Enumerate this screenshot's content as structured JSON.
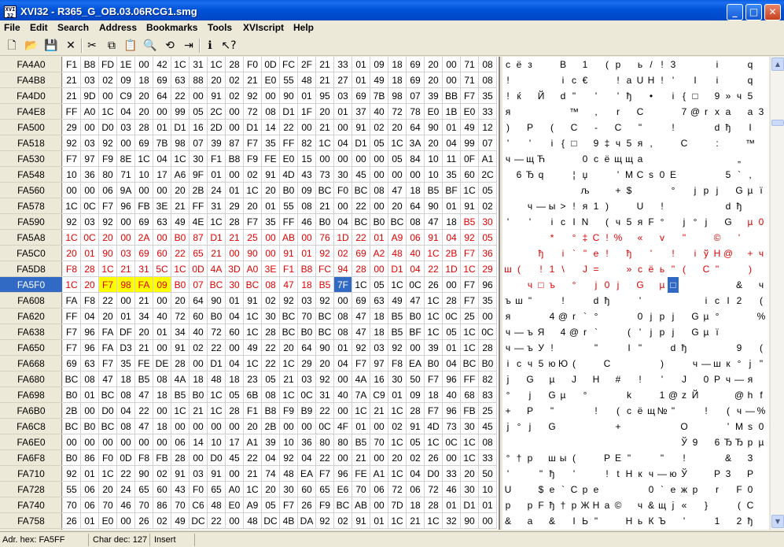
{
  "window": {
    "title": "XVI32 - R365_G_OB.03.06RCG1.smg",
    "app_icon": "XVI32-icon",
    "controls": {
      "minimize": "minimize-icon",
      "maximize": "maximize-icon",
      "close": "close-icon"
    }
  },
  "menu": [
    "File",
    "Edit",
    "Search",
    "Address",
    "Bookmarks",
    "Tools",
    "XVIscript",
    "Help"
  ],
  "toolbar": [
    "new-file-icon",
    "open-folder-icon",
    "save-icon",
    "delete-icon",
    "cut-icon",
    "copy-icon",
    "paste-icon",
    "search-icon",
    "replace-icon",
    "goto-icon",
    "info-icon",
    "help-icon"
  ],
  "addresses": [
    "FA4A0",
    "FA4B8",
    "FA4D0",
    "FA4E8",
    "FA500",
    "FA518",
    "FA530",
    "FA548",
    "FA560",
    "FA578",
    "FA590",
    "FA5A8",
    "FA5C0",
    "FA5D8",
    "FA5F0",
    "FA608",
    "FA620",
    "FA638",
    "FA650",
    "FA668",
    "FA680",
    "FA698",
    "FA6B0",
    "FA6C8",
    "FA6E0",
    "FA6F8",
    "FA710",
    "FA728",
    "FA740",
    "FA758"
  ],
  "selected_row": 14,
  "hex_rows": [
    "F1 B8 FD 1E 00 42 1C 31 1C 28 F0 0D FC 2F 21 33 01 09 18 69 20 00 71 08",
    "21 03 02 09 18 69 63 88 20 02 21 E0 55 48 21 27 01 49 18 69 20 00 71 08",
    "21 9D 00 C9 20 64 22 00 91 02 92 00 90 01 95 03 69 7B 98 07 39 BB F7 35",
    "FF A0 1C 04 20 00 99 05 2C 00 72 08 D1 1F 20 01 37 40 72 78 E0 1B E0 33",
    "29 00 D0 03 28 01 D1 16 2D 00 D1 14 22 00 21 00 91 02 20 64 90 01 49 12",
    "92 03 92 00 69 7B 98 07 39 87 F7 35 FF 82 1C 04 D1 05 1C 3A 20 04 99 07",
    "F7 97 F9 8E 1C 04 1C 30 F1 B8 F9 FE E0 15 00 00 00 00 05 84 10 11 0F A1",
    "10 36 80 71 10 17 A6 9F 01 00 02 91 4D 43 73 30 45 00 00 00 10 35 60 2C",
    "00 00 06 9A 00 00 20 2B 24 01 1C 20 B0 09 BC F0 BC 08 47 18 B5 BF 1C 05",
    "1C 0C F7 96 FB 3E 21 FF 31 29 20 01 55 08 21 00 22 00 20 64 90 01 91 02",
    "92 03 92 00 69 63 49 4E 1C 28 F7 35 FF 46 B0 04 BC B0 BC 08 47 18 B5 30",
    "1C 0C 20 00 2A 00 B0 87 D1 21 25 00 AB 00 76 1D 22 01 A9 06 91 04 92 05",
    "20 01 90 03 69 60 22 65 21 00 90 00 91 01 92 02 69 A2 48 40 1C 2B F7 36",
    "F8 28 1C 21 31 5C 1C 0D 4A 3D A0 3E F1 B8 FC 94 28 00 D1 04 22 1D 1C 29",
    "1C 20 F7 98 FA 09 B0 07 BC 30 BC 08 47 18 B5 7F 1C 05 1C 0C 26 00 F7 96",
    "FA F8 22 00 21 00 20 64 90 01 91 02 92 03 92 00 69 63 49 47 1C 28 F7 35",
    "FF 04 20 01 34 40 72 60 B0 04 1C 30 BC 70 BC 08 47 18 B5 B0 1C 0C 25 00",
    "F7 96 FA DF 20 01 34 40 72 60 1C 28 BC B0 BC 08 47 18 B5 BF 1C 05 1C 0C",
    "F7 96 FA D3 21 00 91 02 22 00 49 22 20 64 90 01 92 03 92 00 39 01 1C 28",
    "69 63 F7 35 FE DE 28 00 D1 04 1C 22 1C 29 20 04 F7 97 F8 EA B0 04 BC B0",
    "BC 08 47 18 B5 08 4A 18 48 18 23 05 21 03 92 00 4A 16 30 50 F7 96 FF 82",
    "B0 01 BC 08 47 18 B5 B0 1C 05 6B 08 1C 0C 31 40 7A C9 01 09 18 40 68 83",
    "2B 00 D0 04 22 00 1C 21 1C 28 F1 B8 F9 B9 22 00 1C 21 1C 28 F7 96 FB 25",
    "BC B0 BC 08 47 18 00 00 00 00 20 2B 00 00 0C 4F 01 00 02 91 4D 73 30 45",
    "00 00 00 00 00 00 06 14 10 17 A1 39 10 36 80 80 B5 70 1C 05 1C 0C 1C 08",
    "B0 86 F0 0D F8 FB 28 00 D0 45 22 04 92 04 22 00 21 00 20 02 26 00 1C 33",
    "92 01 1C 22 90 02 91 03 91 00 21 74 48 EA F7 96 FE A1 1C 04 D0 33 20 50",
    "55 06 20 24 65 60 43 F0 65 A0 1C 20 30 60 65 E6 70 06 72 06 72 46 30 10",
    "70 06 70 46 70 86 70 C6 48 E0 A9 05 F7 26 F9 BC AB 00 7D 18 28 01 D1 01",
    "26 01 E0 00 26 02 49 DC 22 00 48 DC 4B DA 92 02 91 01 1C 21 1C 32 90 00"
  ],
  "text_rows": [
    [
      "с",
      "ё",
      "з",
      "",
      "",
      "В",
      "",
      "1",
      "",
      "(",
      "р",
      "",
      "ь",
      "/",
      "!",
      "3",
      "",
      "",
      "",
      "i",
      "",
      "",
      "q",
      ""
    ],
    [
      "!",
      "",
      "",
      "",
      "",
      "i",
      "с",
      "€",
      "",
      "",
      "!",
      "а",
      "U",
      "H",
      "!",
      "'",
      "",
      "I",
      "",
      "i",
      "",
      "",
      "q",
      ""
    ],
    [
      "!",
      "ќ",
      "",
      "Й",
      "",
      "d",
      "\"",
      "",
      "'",
      "",
      "'",
      "ђ",
      "",
      "•",
      "",
      "і",
      "{",
      "□",
      "",
      "9",
      "»",
      "ч",
      "5",
      ""
    ],
    [
      "я",
      "",
      "",
      "",
      "",
      "",
      "™",
      "",
      ",",
      "",
      "r",
      "",
      "С",
      "",
      "",
      "",
      "7",
      "@",
      "r",
      "x",
      "а",
      "",
      "а",
      "3"
    ],
    [
      ")",
      "",
      "Р",
      "",
      "(",
      "",
      "С",
      "",
      "-",
      "",
      "С",
      "",
      "\"",
      "",
      "",
      "!",
      "",
      "",
      "",
      "d",
      "ђ",
      "",
      "I",
      ""
    ],
    [
      "'",
      "",
      "'",
      "",
      "i",
      "{",
      "□",
      "",
      "9",
      "‡",
      "ч",
      "5",
      "я",
      ",",
      "",
      "",
      "С",
      "",
      "",
      ":",
      "",
      "",
      "™",
      ""
    ],
    [
      "ч",
      "—",
      "щ",
      "Ћ",
      "",
      "",
      "",
      "0",
      "с",
      "ё",
      "щ",
      "щ",
      "а",
      "",
      "",
      "",
      "",
      "",
      "",
      "",
      "",
      "„",
      "",
      ""
    ],
    [
      "",
      "6",
      "Ђ",
      "q",
      "",
      "",
      "¦",
      "џ",
      "",
      "",
      "'",
      "M",
      "С",
      "s",
      "0",
      "E",
      "",
      "",
      "",
      "",
      "5",
      "`",
      ",",
      ""
    ],
    [
      "",
      "",
      "",
      "",
      "",
      "",
      "",
      "љ",
      "",
      "",
      "+",
      "$",
      "",
      "",
      "",
      "°",
      "",
      "j",
      "р",
      "j",
      "",
      "G",
      "µ",
      "ї"
    ],
    [
      "",
      "",
      "ч",
      "—",
      "ы",
      ">",
      "!",
      "я",
      "1",
      ")",
      "",
      "",
      "U",
      "",
      "!",
      "",
      "",
      "",
      "",
      "",
      "d",
      "ђ",
      "",
      ""
    ],
    [
      "'",
      "",
      "'",
      "",
      "i",
      "с",
      "I",
      "N",
      "",
      "(",
      "ч",
      "5",
      "я",
      "F",
      "°",
      "",
      "j",
      "°",
      "j",
      "",
      "G",
      "",
      "µ",
      "0"
    ],
    [
      "",
      "",
      "",
      "",
      "*",
      "",
      "°",
      "‡",
      "С",
      "!",
      "%",
      "",
      "«",
      "",
      "v",
      "",
      "\"",
      "",
      "",
      "©",
      "",
      "'",
      "",
      ""
    ],
    [
      "",
      "",
      "",
      "ђ",
      "",
      "i",
      "`",
      "\"",
      "е",
      "!",
      "",
      "ђ",
      "",
      "'",
      "",
      "!",
      "",
      "i",
      "ў",
      "H",
      "@",
      "",
      "+",
      "ч"
    ],
    [
      "ш",
      "(",
      "",
      "!",
      "1",
      "\\",
      "",
      "J",
      "=",
      "",
      "",
      "»",
      "с",
      "ё",
      "ь",
      "\"",
      "(",
      "",
      "С",
      "\"",
      "",
      "",
      ")",
      ""
    ],
    [
      "",
      "",
      "ч",
      "□",
      "ъ",
      "",
      "°",
      "",
      "j",
      "0",
      "j",
      "",
      "G",
      "",
      "µ",
      "□",
      "",
      "",
      "",
      "",
      "",
      "&",
      "",
      "ч"
    ],
    [
      "ъ",
      "ш",
      "\"",
      "",
      "",
      "!",
      "",
      "",
      "d",
      "ђ",
      "",
      "",
      "'",
      "",
      "",
      "",
      "",
      "",
      "i",
      "с",
      "I",
      "2",
      "",
      "("
    ],
    [
      "я",
      "",
      "",
      "",
      "4",
      "@",
      "r",
      "`",
      "°",
      "",
      "",
      "",
      "0",
      "j",
      "р",
      "j",
      "",
      "G",
      "µ",
      "°",
      "",
      "",
      "",
      "%"
    ],
    [
      "ч",
      "—",
      "ъ",
      "Я",
      "",
      "4",
      "@",
      "r",
      "`",
      "",
      "",
      "(",
      "'",
      "j",
      "р",
      "j",
      "",
      "G",
      "µ",
      "ї",
      "",
      "",
      "",
      ""
    ],
    [
      "ч",
      "—",
      "ъ",
      "У",
      "!",
      "",
      "",
      "",
      "\"",
      "",
      "",
      "I",
      "\"",
      "",
      "",
      "d",
      "ђ",
      "",
      "",
      "",
      "",
      "9",
      "",
      "("
    ],
    [
      "i",
      "с",
      "ч",
      "5",
      "ю",
      "Ю",
      "(",
      "",
      "",
      "С",
      "",
      "",
      "",
      "",
      ")",
      "",
      "",
      "ч",
      "—",
      "ш",
      "к",
      "°",
      "ј",
      "\""
    ],
    [
      "ј",
      "",
      "G",
      "",
      "µ",
      "",
      "J",
      "",
      "Н",
      "",
      "#",
      "",
      "!",
      "",
      "'",
      "",
      "J",
      "",
      "0",
      "Р",
      "ч",
      "—",
      "я",
      ""
    ],
    [
      "°",
      "",
      "j",
      "",
      "G",
      "µ",
      "",
      "°",
      "",
      "",
      "",
      "k",
      "",
      "",
      "1",
      "@",
      "z",
      "Й",
      "",
      "",
      "",
      "@",
      "h",
      "f"
    ],
    [
      "+",
      "",
      "Р",
      "",
      "\"",
      "",
      "",
      "",
      "!",
      "",
      "(",
      "с",
      "ё",
      "щ",
      "№",
      "\"",
      "",
      "",
      "!",
      "",
      "(",
      "ч",
      "—",
      "%"
    ],
    [
      "ј",
      "°",
      "j",
      "",
      "G",
      "",
      "",
      "",
      "",
      "",
      "+",
      "",
      "",
      "",
      "",
      "",
      "О",
      "",
      "",
      "",
      "'",
      "M",
      "s",
      "0",
      "E"
    ],
    [
      "",
      "",
      "",
      "",
      "",
      "",
      "",
      "",
      "",
      "",
      "",
      "",
      "",
      "",
      "",
      "",
      "Ў",
      "9",
      "",
      "6",
      "Ђ",
      "Ђ",
      "р",
      "µ",
      "р"
    ],
    [
      "°",
      "†",
      "р",
      "",
      "ш",
      "ы",
      "(",
      "",
      "",
      "Р",
      "Е",
      "\"",
      "",
      "",
      "\"",
      "",
      "!",
      "",
      "",
      "",
      "&",
      "",
      "3",
      ""
    ],
    [
      "'",
      "",
      "",
      "\"",
      "ђ",
      "",
      "'",
      "",
      "",
      "!",
      "t",
      "Н",
      "к",
      "ч",
      "—",
      "ю",
      "Ў",
      "",
      "",
      "Р",
      "3",
      "",
      "Р",
      ""
    ],
    [
      "U",
      "",
      "",
      "$",
      "е",
      "`",
      "С",
      "р",
      "е",
      "",
      "",
      "",
      "",
      "0",
      "`",
      "е",
      "ж",
      "р",
      "",
      "r",
      "",
      "F",
      "0",
      ""
    ],
    [
      "р",
      "",
      "р",
      "F",
      "ђ",
      "†",
      "р",
      "Ж",
      "Н",
      "а",
      "©",
      "",
      "ч",
      "&",
      "щ",
      "ј",
      "«",
      "",
      "}",
      "",
      "",
      "(",
      "С",
      ""
    ],
    [
      "&",
      "",
      "а",
      "",
      "&",
      "",
      "I",
      "Ь",
      "\"",
      "",
      "",
      "Н",
      "ь",
      "К",
      "Ъ",
      "",
      "'",
      "",
      "",
      "1",
      "",
      "2",
      "ђ",
      ""
    ]
  ],
  "red_ranges": [
    {
      "row": 10,
      "from": 22,
      "to": 23
    },
    {
      "row": 11,
      "from": 0,
      "to": 23
    },
    {
      "row": 12,
      "from": 0,
      "to": 23
    },
    {
      "row": 13,
      "from": 0,
      "to": 23
    },
    {
      "row": 14,
      "from": 0,
      "to": 14
    }
  ],
  "highlight": {
    "row": 14,
    "from": 2,
    "to": 5
  },
  "cursor": {
    "row": 14,
    "col": 15
  },
  "status": {
    "address": "Adr. hex: FA5FF",
    "char": "Char dec: 127",
    "mode": "Insert"
  }
}
